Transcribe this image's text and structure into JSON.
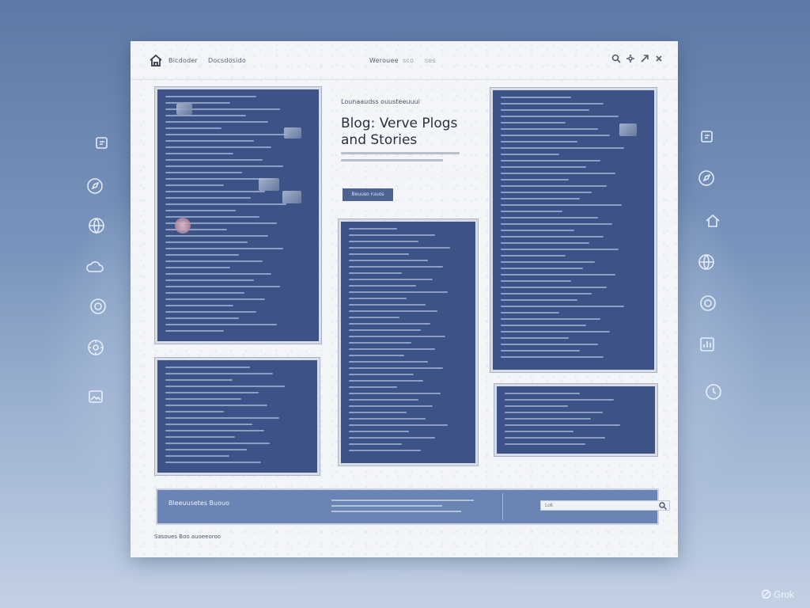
{
  "nav": {
    "brand": "Bicdoder",
    "links": [
      "Docsdosido",
      "Werouee",
      "sco",
      "ses"
    ],
    "icons": [
      "search-icon",
      "gear-icon",
      "share-icon",
      "close-icon"
    ]
  },
  "hero": {
    "kicker": "Lounaaudss ouusteeuuui",
    "title": "Blog: Verve Plogs and Stories",
    "button_label": "Beuuso ruuos"
  },
  "footer": {
    "title": "Bleeuusetes Buouo",
    "search_placeholder": "Lok",
    "copyright": "Sasoues Boo auoeeoroo"
  },
  "side_icons_left": [
    "note-icon",
    "compass-icon",
    "globe-icon",
    "cloud-icon",
    "target-icon",
    "settings-icon",
    "image-icon"
  ],
  "side_icons_right": [
    "note-icon",
    "compass-icon",
    "home-icon",
    "globe-icon",
    "target-icon",
    "chart-icon",
    "clock-icon"
  ],
  "watermark": "Grok",
  "colors": {
    "background": "#6d88b3",
    "page": "#f3f5f9",
    "panel": "#3d5286",
    "footer_bar": "#6a84b3",
    "button": "#4d6390"
  }
}
